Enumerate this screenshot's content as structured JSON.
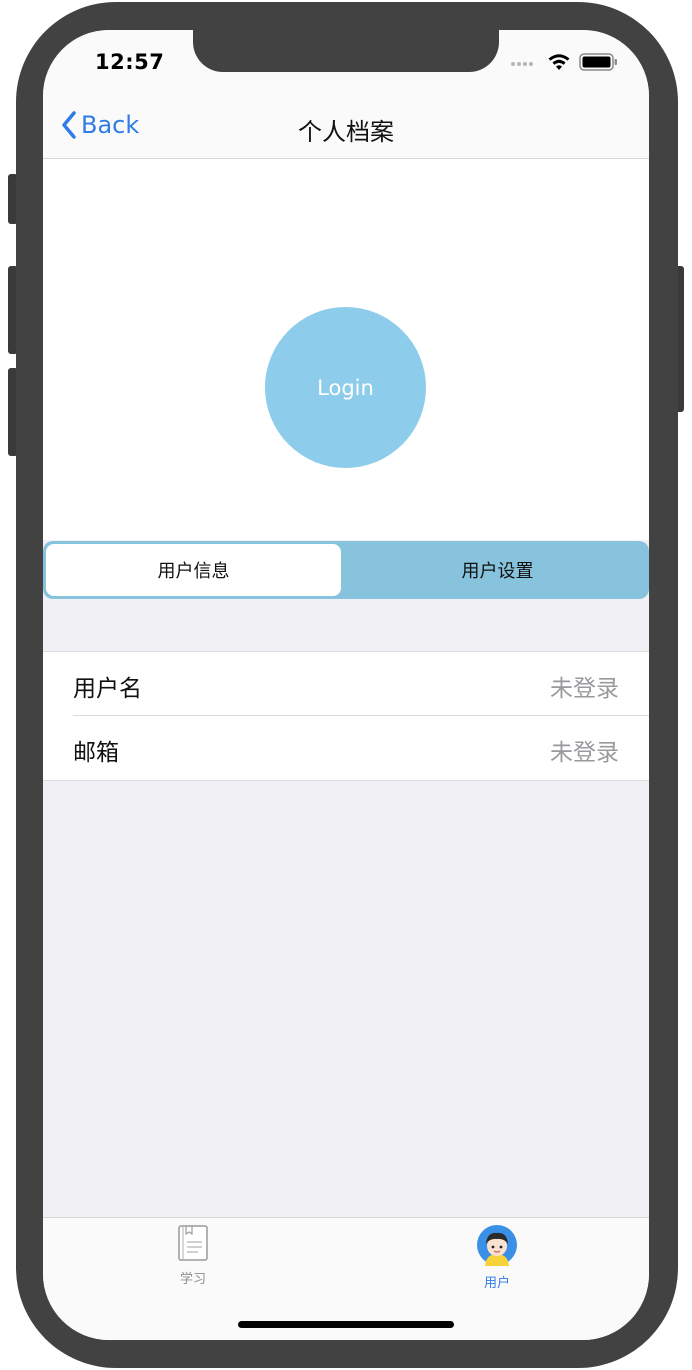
{
  "status": {
    "time": "12:57"
  },
  "nav": {
    "back_label": "Back",
    "title": "个人档案"
  },
  "profile": {
    "login_label": "Login"
  },
  "segment": {
    "items": [
      {
        "label": "用户信息",
        "selected": true
      },
      {
        "label": "用户设置",
        "selected": false
      }
    ]
  },
  "rows": [
    {
      "label": "用户名",
      "value": "未登录"
    },
    {
      "label": "邮箱",
      "value": "未登录"
    }
  ],
  "tabbar": {
    "items": [
      {
        "label": "学习",
        "icon": "notebook-icon",
        "active": false
      },
      {
        "label": "用户",
        "icon": "user-avatar-icon",
        "active": true
      }
    ]
  },
  "colors": {
    "accent": "#2f7ce6",
    "login_circle": "#8dcdeb",
    "segment_bg": "#87c3dd",
    "frame": "#424242"
  }
}
